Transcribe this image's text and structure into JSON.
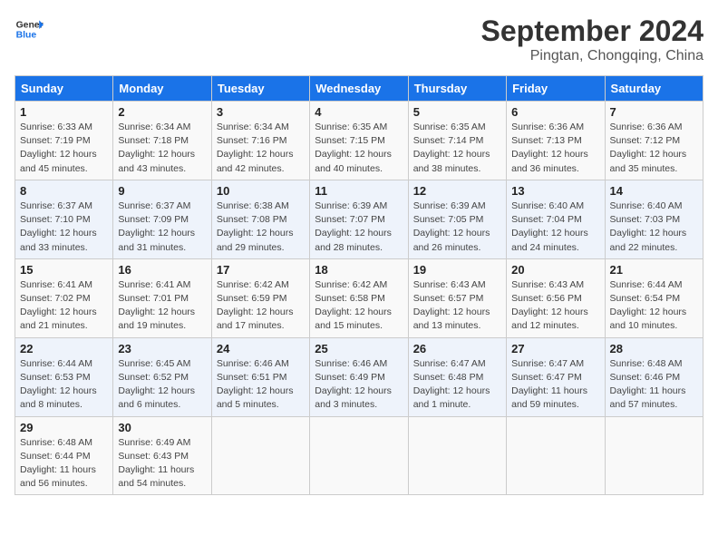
{
  "header": {
    "logo_line1": "General",
    "logo_line2": "Blue",
    "month": "September 2024",
    "location": "Pingtan, Chongqing, China"
  },
  "days_of_week": [
    "Sunday",
    "Monday",
    "Tuesday",
    "Wednesday",
    "Thursday",
    "Friday",
    "Saturday"
  ],
  "weeks": [
    [
      {
        "day": "1",
        "info": "Sunrise: 6:33 AM\nSunset: 7:19 PM\nDaylight: 12 hours\nand 45 minutes."
      },
      {
        "day": "2",
        "info": "Sunrise: 6:34 AM\nSunset: 7:18 PM\nDaylight: 12 hours\nand 43 minutes."
      },
      {
        "day": "3",
        "info": "Sunrise: 6:34 AM\nSunset: 7:16 PM\nDaylight: 12 hours\nand 42 minutes."
      },
      {
        "day": "4",
        "info": "Sunrise: 6:35 AM\nSunset: 7:15 PM\nDaylight: 12 hours\nand 40 minutes."
      },
      {
        "day": "5",
        "info": "Sunrise: 6:35 AM\nSunset: 7:14 PM\nDaylight: 12 hours\nand 38 minutes."
      },
      {
        "day": "6",
        "info": "Sunrise: 6:36 AM\nSunset: 7:13 PM\nDaylight: 12 hours\nand 36 minutes."
      },
      {
        "day": "7",
        "info": "Sunrise: 6:36 AM\nSunset: 7:12 PM\nDaylight: 12 hours\nand 35 minutes."
      }
    ],
    [
      {
        "day": "8",
        "info": "Sunrise: 6:37 AM\nSunset: 7:10 PM\nDaylight: 12 hours\nand 33 minutes."
      },
      {
        "day": "9",
        "info": "Sunrise: 6:37 AM\nSunset: 7:09 PM\nDaylight: 12 hours\nand 31 minutes."
      },
      {
        "day": "10",
        "info": "Sunrise: 6:38 AM\nSunset: 7:08 PM\nDaylight: 12 hours\nand 29 minutes."
      },
      {
        "day": "11",
        "info": "Sunrise: 6:39 AM\nSunset: 7:07 PM\nDaylight: 12 hours\nand 28 minutes."
      },
      {
        "day": "12",
        "info": "Sunrise: 6:39 AM\nSunset: 7:05 PM\nDaylight: 12 hours\nand 26 minutes."
      },
      {
        "day": "13",
        "info": "Sunrise: 6:40 AM\nSunset: 7:04 PM\nDaylight: 12 hours\nand 24 minutes."
      },
      {
        "day": "14",
        "info": "Sunrise: 6:40 AM\nSunset: 7:03 PM\nDaylight: 12 hours\nand 22 minutes."
      }
    ],
    [
      {
        "day": "15",
        "info": "Sunrise: 6:41 AM\nSunset: 7:02 PM\nDaylight: 12 hours\nand 21 minutes."
      },
      {
        "day": "16",
        "info": "Sunrise: 6:41 AM\nSunset: 7:01 PM\nDaylight: 12 hours\nand 19 minutes."
      },
      {
        "day": "17",
        "info": "Sunrise: 6:42 AM\nSunset: 6:59 PM\nDaylight: 12 hours\nand 17 minutes."
      },
      {
        "day": "18",
        "info": "Sunrise: 6:42 AM\nSunset: 6:58 PM\nDaylight: 12 hours\nand 15 minutes."
      },
      {
        "day": "19",
        "info": "Sunrise: 6:43 AM\nSunset: 6:57 PM\nDaylight: 12 hours\nand 13 minutes."
      },
      {
        "day": "20",
        "info": "Sunrise: 6:43 AM\nSunset: 6:56 PM\nDaylight: 12 hours\nand 12 minutes."
      },
      {
        "day": "21",
        "info": "Sunrise: 6:44 AM\nSunset: 6:54 PM\nDaylight: 12 hours\nand 10 minutes."
      }
    ],
    [
      {
        "day": "22",
        "info": "Sunrise: 6:44 AM\nSunset: 6:53 PM\nDaylight: 12 hours\nand 8 minutes."
      },
      {
        "day": "23",
        "info": "Sunrise: 6:45 AM\nSunset: 6:52 PM\nDaylight: 12 hours\nand 6 minutes."
      },
      {
        "day": "24",
        "info": "Sunrise: 6:46 AM\nSunset: 6:51 PM\nDaylight: 12 hours\nand 5 minutes."
      },
      {
        "day": "25",
        "info": "Sunrise: 6:46 AM\nSunset: 6:49 PM\nDaylight: 12 hours\nand 3 minutes."
      },
      {
        "day": "26",
        "info": "Sunrise: 6:47 AM\nSunset: 6:48 PM\nDaylight: 12 hours\nand 1 minute."
      },
      {
        "day": "27",
        "info": "Sunrise: 6:47 AM\nSunset: 6:47 PM\nDaylight: 11 hours\nand 59 minutes."
      },
      {
        "day": "28",
        "info": "Sunrise: 6:48 AM\nSunset: 6:46 PM\nDaylight: 11 hours\nand 57 minutes."
      }
    ],
    [
      {
        "day": "29",
        "info": "Sunrise: 6:48 AM\nSunset: 6:44 PM\nDaylight: 11 hours\nand 56 minutes."
      },
      {
        "day": "30",
        "info": "Sunrise: 6:49 AM\nSunset: 6:43 PM\nDaylight: 11 hours\nand 54 minutes."
      },
      {
        "day": "",
        "info": ""
      },
      {
        "day": "",
        "info": ""
      },
      {
        "day": "",
        "info": ""
      },
      {
        "day": "",
        "info": ""
      },
      {
        "day": "",
        "info": ""
      }
    ]
  ]
}
